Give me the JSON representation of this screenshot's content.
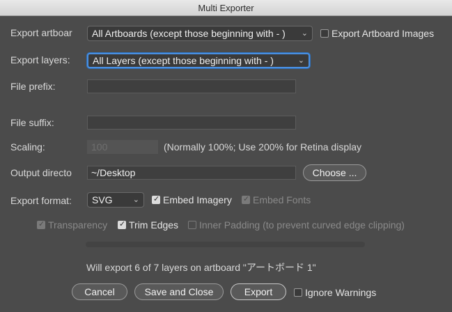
{
  "window": {
    "title": "Multi Exporter"
  },
  "artboard": {
    "label": "Export artboar",
    "selected": "All Artboards (except those beginning with - )",
    "images_checkbox_label": "Export Artboard Images",
    "images_checked": false
  },
  "layers": {
    "label": "Export layers:",
    "selected": "All Layers (except those beginning with - )"
  },
  "prefix": {
    "label": "File prefix:",
    "value": ""
  },
  "suffix": {
    "label": "File suffix:",
    "value": ""
  },
  "scaling": {
    "label": "Scaling:",
    "value": "100",
    "hint": "(Normally 100%; Use 200% for Retina display"
  },
  "output": {
    "label": "Output directo",
    "value": "~/Desktop",
    "choose_label": "Choose ..."
  },
  "format": {
    "label": "Export format:",
    "selected": "SVG",
    "embed_imagery_label": "Embed Imagery",
    "embed_imagery_checked": true,
    "embed_fonts_label": "Embed Fonts",
    "embed_fonts_checked": true
  },
  "options": {
    "transparency_label": "Transparency",
    "transparency_checked": true,
    "trim_edges_label": "Trim Edges",
    "trim_edges_checked": true,
    "inner_padding_label": "Inner Padding (to prevent curved edge clipping)",
    "inner_padding_checked": false
  },
  "progress": {
    "value": 0
  },
  "status": {
    "text": "Will export 6 of 7 layers on artboard \"アートボード 1\""
  },
  "buttons": {
    "cancel": "Cancel",
    "save_close": "Save and Close",
    "export": "Export",
    "ignore_warnings_label": "Ignore Warnings",
    "ignore_warnings_checked": false
  },
  "colors": {
    "background": "#4b4b4b",
    "focus_ring": "#4a90e2"
  }
}
